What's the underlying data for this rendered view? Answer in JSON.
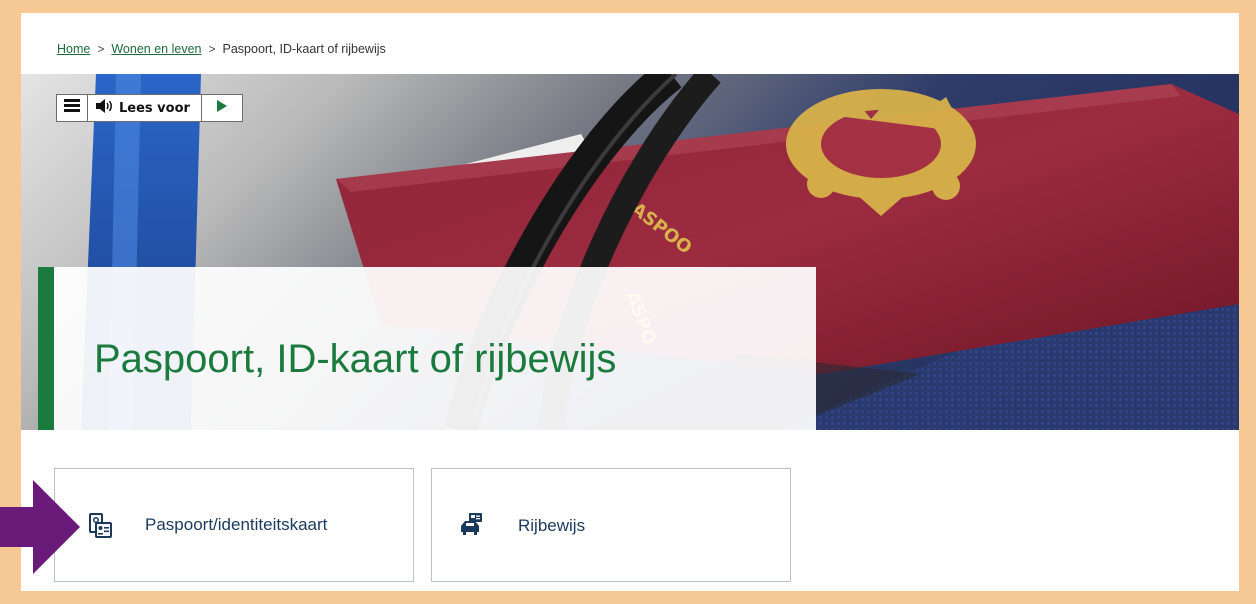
{
  "breadcrumb": {
    "home": "Home",
    "section": "Wonen en leven",
    "current": "Paspoort, ID-kaart of rijbewijs",
    "separator": ">"
  },
  "reader": {
    "menu_icon": "hamburger-icon",
    "listen_icon": "speaker-icon",
    "listen_label": "Lees voor",
    "play_icon": "play-icon"
  },
  "hero": {
    "image": "passport-photo"
  },
  "page": {
    "title": "Paspoort, ID-kaart of rijbewijs"
  },
  "cards": [
    {
      "label": "Paspoort/identiteitskaart",
      "icon": "passport-id-icon"
    },
    {
      "label": "Rijbewijs",
      "icon": "driving-license-icon"
    }
  ],
  "colors": {
    "accent": "#1b7a3e",
    "frame": "#f6c893",
    "annotation": "#6a1b7a",
    "link": "#1d6b3b",
    "card_text": "#1a3a5c"
  }
}
